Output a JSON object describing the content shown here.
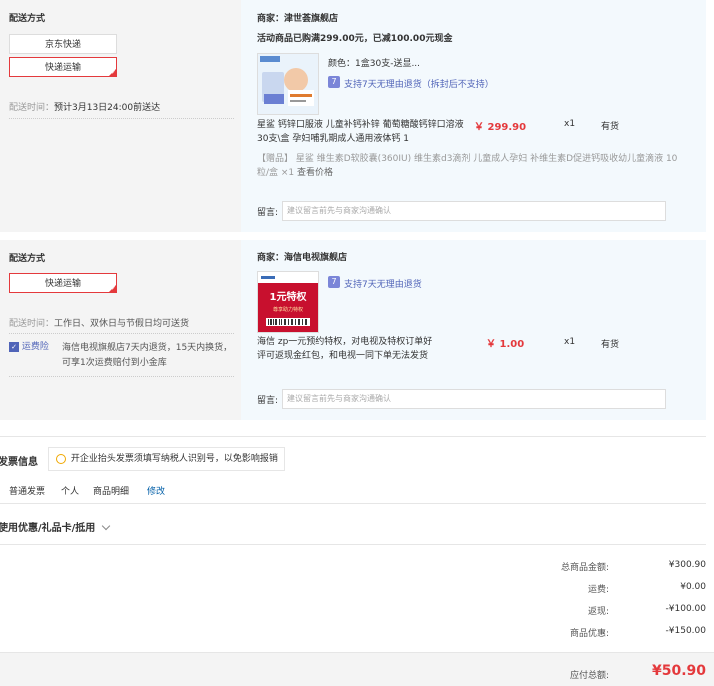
{
  "shipping1": {
    "title": "配送方式",
    "options": [
      "京东快递",
      "快递运输"
    ],
    "time_label": "配送时间：",
    "time_value": "预计3月13日24:00前送达"
  },
  "shop1": {
    "merchant_label": "商家：",
    "merchant": "津世荟旗舰店",
    "promo": "活动商品已购满299.00元，已减100.00元现金",
    "color_label": "颜色：",
    "color_value": "1盒30支-送显...",
    "return_policy": "支持7天无理由退货（拆封后不支持）",
    "product_name": "星鲨 钙锌口服液 儿童补钙补锌 葡萄糖酸钙锌口溶液30支\\盒 孕妇哺乳期成人通用液体钙 1",
    "price": "￥ 299.90",
    "qty": "x1",
    "stock": "有货",
    "gift_tag": "【赠品】",
    "gift_text": "星鲨 维生素D软胶囊(360IU) 维生素d3滴剂 儿童成人孕妇 补维生素D促进钙吸收幼儿童滴液 10粒/盒 ×1",
    "gift_link": "查看价格",
    "message_label": "留言:",
    "message_placeholder": "建议留言前先与商家沟通确认"
  },
  "shipping2": {
    "title": "配送方式",
    "option": "快递运输",
    "time_label": "配送时间：",
    "time_value": "工作日、双休日与节假日均可送货",
    "insurance_badge": "运费险",
    "insurance_text": "海信电视旗舰店7天内退货，15天内换货，可享1次运费赔付到小金库"
  },
  "shop2": {
    "merchant_label": "商家：",
    "merchant": "海信电视旗舰店",
    "return_policy": "支持7天无理由退货",
    "product_name": "海信 zp一元预约特权，对电视及特权订单好评可返现金红包，和电视一同下单无法发货",
    "price": "￥ 1.00",
    "qty": "x1",
    "stock": "有货",
    "img_big": "1元特权",
    "img_small": "尊享助力特权",
    "message_label": "留言:",
    "message_placeholder": "建议留言前先与商家沟通确认"
  },
  "invoice": {
    "title": "发票信息",
    "tip": "开企业抬头发票须填写纳税人识别号，以免影响报销",
    "type": "普通发票",
    "person": "个人",
    "content": "商品明细",
    "edit": "修改"
  },
  "coupon": {
    "title": "使用优惠/礼品卡/抵用"
  },
  "summary": {
    "total_label": "总商品金额:",
    "total_value": "¥300.90",
    "freight_label": "运费:",
    "freight_value": "¥0.00",
    "cashback_label": "返现:",
    "cashback_value": "-¥100.00",
    "discount_label": "商品优惠:",
    "discount_value": "-¥150.00",
    "payable_label": "应付总额:",
    "payable_value": "¥50.90"
  },
  "colors": {
    "accent": "#e4393c",
    "blue_panel": "#f3f9fd",
    "gray_panel": "#f4f4f4",
    "link": "#005ea7"
  }
}
